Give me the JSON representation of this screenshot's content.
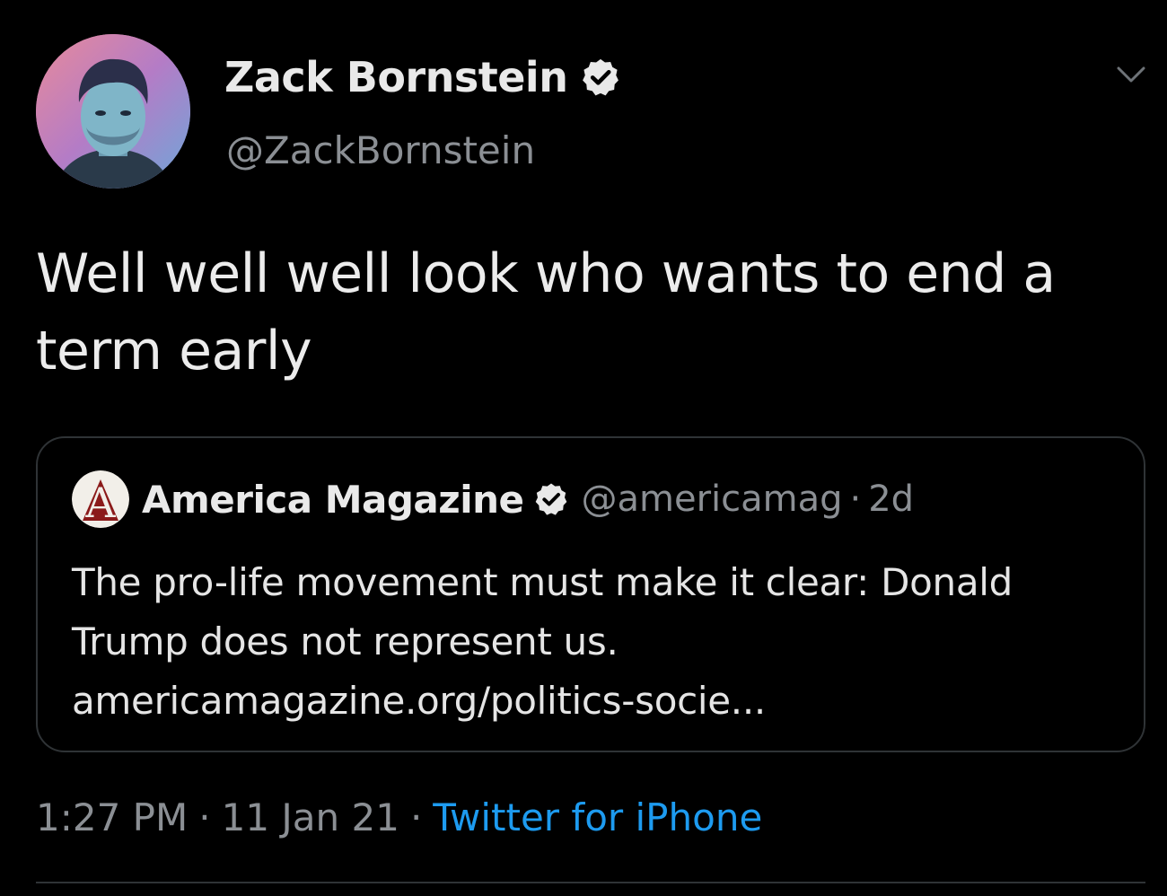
{
  "colors": {
    "background": "#000000",
    "text": "#e7e7e7",
    "muted": "#8b8f94",
    "link": "#1d9bf0",
    "border": "#2f3336"
  },
  "tweet": {
    "author_name": "Zack Bornstein",
    "author_handle": "@ZackBornstein",
    "verified": true,
    "avatar_icon": "user-avatar",
    "menu_icon": "chevron-down-icon",
    "text": "Well well well look who wants to end a term early",
    "timestamp_time": "1:27 PM",
    "timestamp_date": "11 Jan 21",
    "separator": "·",
    "source": "Twitter for iPhone"
  },
  "quote": {
    "logo_letter": "A",
    "name": "America Magazine",
    "verified": true,
    "handle": "@americamag",
    "separator": "·",
    "age": "2d",
    "text_line1": "The pro-life movement must make it clear: Donald",
    "text_line2": "Trump does not represent us.",
    "link": "americamagazine.org/politics-socie..."
  }
}
